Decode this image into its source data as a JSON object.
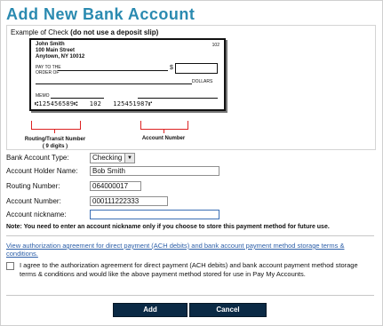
{
  "title": "Add New Bank Account",
  "example": {
    "caption_prefix": "Example of Check",
    "caption_bold": "(do not use a deposit slip)",
    "check": {
      "holder_line1": "John Smith",
      "holder_line2": "100 Main Street",
      "holder_line3": "Anytown, NY 10012",
      "check_number": "102",
      "pay_to": "PAY TO THE\nORDER OF",
      "dollar_sign": "$",
      "dollars_label": "DOLLARS",
      "memo_label": "MEMO",
      "micr_routing": "⑆125456589⑆",
      "micr_check": "102",
      "micr_account": "125451987⑈"
    },
    "routing_label": "Routing/Transit Number\n( 9 digits )",
    "account_label": "Account Number"
  },
  "form": {
    "account_type_label": "Bank Account Type:",
    "account_type_value": "Checking",
    "holder_name_label": "Account Holder Name:",
    "holder_name_value": "Bob Smith",
    "routing_label": "Routing Number:",
    "routing_value": "064000017",
    "account_number_label": "Account Number:",
    "account_number_value": "000111222333",
    "nickname_label": "Account nickname:",
    "nickname_value": ""
  },
  "note": "Note: You need to enter an account nickname only if you choose to store this payment method for future use.",
  "agreement_link": "View authorization agreement for direct payment (ACH debits) and bank account payment method storage terms & conditions.",
  "agreement_text": "I agree to the authorization agreement for direct payment (ACH debits) and bank account payment method storage terms & conditions and would like the above payment method stored for use in Pay My Accounts.",
  "buttons": {
    "add": "Add",
    "cancel": "Cancel"
  }
}
